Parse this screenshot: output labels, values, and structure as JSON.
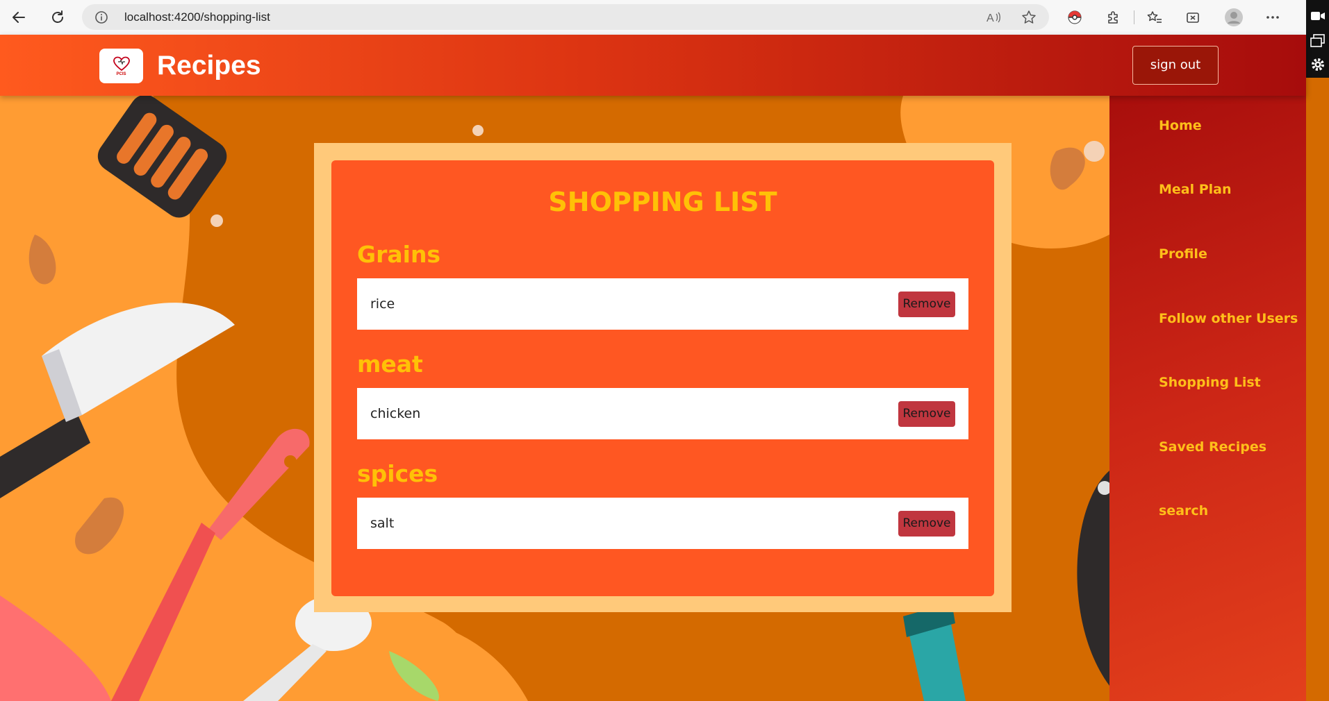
{
  "browser": {
    "url": "localhost:4200/shopping-list"
  },
  "header": {
    "logo_caption": "PCIS",
    "brand": "Recipes",
    "signout_label": "sign out"
  },
  "sidebar": {
    "items": [
      {
        "label": "Home"
      },
      {
        "label": "Meal Plan"
      },
      {
        "label": "Profile"
      },
      {
        "label": "Follow other Users"
      },
      {
        "label": "Shopping List"
      },
      {
        "label": "Saved Recipes"
      },
      {
        "label": "search"
      }
    ]
  },
  "main": {
    "title": "SHOPPING LIST",
    "categories": [
      {
        "name": "Grains",
        "items": [
          {
            "text": "rice",
            "action": "Remove"
          }
        ]
      },
      {
        "name": "meat",
        "items": [
          {
            "text": "chicken",
            "action": "Remove"
          }
        ]
      },
      {
        "name": "spices",
        "items": [
          {
            "text": "salt",
            "action": "Remove"
          }
        ]
      }
    ]
  },
  "colors": {
    "header_start": "#ff5a1e",
    "header_end": "#a60c0c",
    "card": "#ff5722",
    "card_frame": "#ffc97a",
    "accent_text": "#ffc107",
    "sidebar_link": "#ffbf1a",
    "remove_button": "#c0363f"
  },
  "icons": [
    "back-arrow-icon",
    "refresh-icon",
    "info-icon",
    "read-aloud-icon",
    "favorite-star-icon",
    "pokeball-extension-icon",
    "extensions-icon",
    "favorites-icon",
    "collections-icon",
    "profile-avatar-icon",
    "more-options-icon",
    "video-icon",
    "windows-icon",
    "settings-gear-icon",
    "heart-logo-icon"
  ]
}
